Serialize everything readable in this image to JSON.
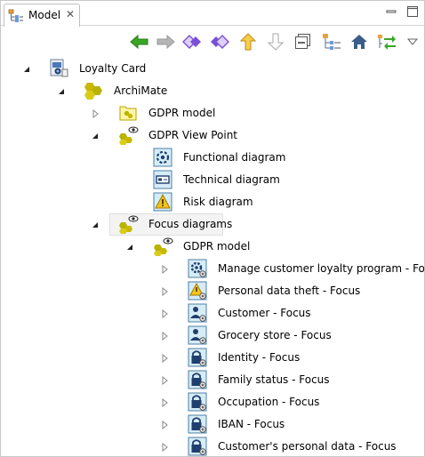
{
  "tab": {
    "label": "Model",
    "icon": "model-tree-icon"
  },
  "window": {
    "minimize_icon": "minimize-icon",
    "maximize_icon": "maximize-icon"
  },
  "toolbar": {
    "buttons": [
      {
        "icon": "back-arrow-icon",
        "enabled": true
      },
      {
        "icon": "forward-arrow-icon",
        "enabled": false
      },
      {
        "icon": "previous-diamond-icon",
        "enabled": true
      },
      {
        "icon": "next-diamond-icon",
        "enabled": true
      },
      {
        "icon": "go-up-icon",
        "enabled": true
      },
      {
        "icon": "go-down-icon",
        "enabled": false
      },
      {
        "icon": "collapse-all-icon",
        "enabled": true
      },
      {
        "icon": "show-tree-icon",
        "enabled": true
      },
      {
        "icon": "home-icon",
        "enabled": true
      },
      {
        "icon": "sync-icon",
        "enabled": true
      },
      {
        "icon": "view-menu-icon",
        "enabled": true
      }
    ]
  },
  "tree": {
    "items": [
      {
        "label": "Loyalty Card",
        "icon": "model-project-icon",
        "level": 0,
        "expanded": true
      },
      {
        "label": "ArchiMate",
        "icon": "archimate-folder-icon",
        "level": 1,
        "expanded": true
      },
      {
        "label": "GDPR model",
        "icon": "package-folder-icon",
        "level": 2,
        "expanded": false
      },
      {
        "label": "GDPR View Point",
        "icon": "viewpoint-icon",
        "level": 2,
        "expanded": true
      },
      {
        "label": "Functional diagram",
        "icon": "functional-diagram-icon",
        "level": 3
      },
      {
        "label": "Technical diagram",
        "icon": "technical-diagram-icon",
        "level": 3
      },
      {
        "label": "Risk diagram",
        "icon": "risk-diagram-icon",
        "level": 3
      },
      {
        "label": "Focus diagrams",
        "icon": "viewpoint-icon",
        "level": 2,
        "expanded": true,
        "selected": true
      },
      {
        "label": "GDPR model",
        "icon": "viewpoint-icon",
        "level": 3,
        "expanded": true
      },
      {
        "label": "Manage customer loyalty program - Focus",
        "icon": "process-focus-icon",
        "level": 4,
        "expanded": false
      },
      {
        "label": "Personal data theft - Focus",
        "icon": "risk-focus-icon",
        "level": 4,
        "expanded": false
      },
      {
        "label": "Customer - Focus",
        "icon": "actor-focus-icon",
        "level": 4,
        "expanded": false
      },
      {
        "label": "Grocery store - Focus",
        "icon": "actor-focus-icon",
        "level": 4,
        "expanded": false
      },
      {
        "label": "Identity - Focus",
        "icon": "data-lock-focus-icon",
        "level": 4,
        "expanded": false
      },
      {
        "label": "Family status - Focus",
        "icon": "data-lock-focus-icon",
        "level": 4,
        "expanded": false
      },
      {
        "label": "Occupation - Focus",
        "icon": "data-lock-focus-icon",
        "level": 4,
        "expanded": false
      },
      {
        "label": "IBAN - Focus",
        "icon": "data-lock-focus-icon",
        "level": 4,
        "expanded": false
      },
      {
        "label": "Customer's personal data - Focus",
        "icon": "data-lock-focus-icon",
        "level": 4,
        "expanded": false
      }
    ]
  },
  "colors": {
    "selection": "#f3f3f3",
    "green_arrow": "#3aa526",
    "purple": "#7a50d8",
    "yellow": "#f0c419",
    "olive": "#b7b300"
  }
}
